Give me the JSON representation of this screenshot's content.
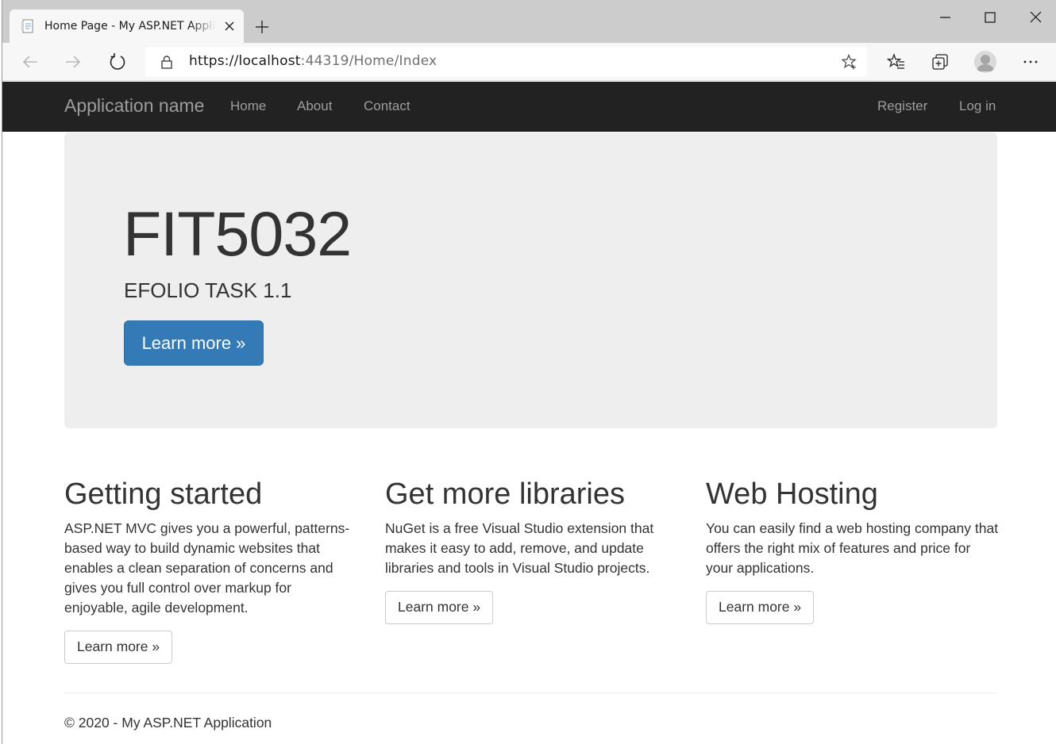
{
  "browser": {
    "tab_title": "Home Page - My ASP.NET Application",
    "url_host": "https://localhost",
    "url_rest": ":44319/Home/Index"
  },
  "navbar": {
    "brand": "Application name",
    "links": [
      "Home",
      "About",
      "Contact"
    ],
    "right_links": [
      "Register",
      "Log in"
    ]
  },
  "jumbotron": {
    "title": "FIT5032",
    "lead": "EFOLIO TASK 1.1",
    "button": "Learn more »"
  },
  "columns": [
    {
      "heading": "Getting started",
      "text": "ASP.NET MVC gives you a powerful, patterns-based way to build dynamic websites that enables a clean separation of concerns and gives you full control over markup for enjoyable, agile development.",
      "button": "Learn more »"
    },
    {
      "heading": "Get more libraries",
      "text": "NuGet is a free Visual Studio extension that makes it easy to add, remove, and update libraries and tools in Visual Studio projects.",
      "button": "Learn more »"
    },
    {
      "heading": "Web Hosting",
      "text": "You can easily find a web hosting company that offers the right mix of features and price for your applications.",
      "button": "Learn more »"
    }
  ],
  "footer": {
    "text": "© 2020 - My ASP.NET Application"
  },
  "icons": {
    "tab_favicon": "page-icon",
    "tab_close": "close-icon",
    "new_tab": "plus-icon",
    "minimize": "minimize-icon",
    "maximize": "maximize-icon",
    "close_window": "close-icon",
    "back": "back-arrow-icon",
    "forward": "forward-arrow-icon",
    "refresh": "refresh-icon",
    "lock": "lock-icon",
    "add_favorite": "star-add-icon",
    "favorites": "favorites-icon",
    "collections": "collections-icon",
    "profile": "profile-avatar-icon",
    "more": "more-icon"
  },
  "colors": {
    "navbar_bg": "#222222",
    "navbar_link": "#9d9d9d",
    "jumbotron_bg": "#eeeeee",
    "primary_button": "#337ab7",
    "text": "#333333"
  }
}
